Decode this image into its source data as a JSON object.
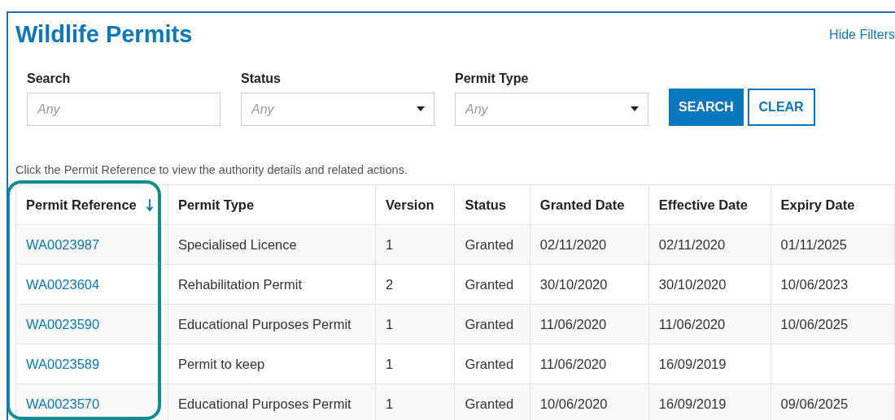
{
  "title": "Wildlife Permits",
  "hide_filters_link": "Hide Filters",
  "filters": [
    {
      "kind": "text",
      "label": "Search",
      "placeholder": "Any"
    },
    {
      "kind": "select",
      "label": "Status",
      "placeholder": "Any"
    },
    {
      "kind": "select",
      "label": "Permit Type",
      "placeholder": "Any"
    }
  ],
  "buttons": [
    {
      "label": "SEARCH",
      "kind": "primary"
    },
    {
      "label": "CLEAR",
      "kind": "secondary"
    }
  ],
  "hint": "Click the Permit Reference to view the authority details and related actions.",
  "table": {
    "columns": [
      {
        "label": "Permit Reference",
        "sorted": true,
        "highlighted": true
      },
      {
        "label": "Permit Type",
        "sorted": false,
        "highlighted": false
      },
      {
        "label": "Version",
        "sorted": false,
        "highlighted": false
      },
      {
        "label": "Status",
        "sorted": false,
        "highlighted": false
      },
      {
        "label": "Granted Date",
        "sorted": false,
        "highlighted": false
      },
      {
        "label": "Effective Date",
        "sorted": false,
        "highlighted": false
      },
      {
        "label": "Expiry Date",
        "sorted": false,
        "highlighted": false
      }
    ],
    "rows": [
      [
        "WA0023987",
        "Specialised Licence",
        "1",
        "Granted",
        "02/11/2020",
        "02/11/2020",
        "01/11/2025"
      ],
      [
        "WA0023604",
        "Rehabilitation Permit",
        "2",
        "Granted",
        "30/10/2020",
        "30/10/2020",
        "10/06/2023"
      ],
      [
        "WA0023590",
        "Educational Purposes Permit",
        "1",
        "Granted",
        "11/06/2020",
        "11/06/2020",
        "10/06/2025"
      ],
      [
        "WA0023589",
        "Permit to keep",
        "1",
        "Granted",
        "11/06/2020",
        "16/09/2019",
        ""
      ],
      [
        "WA0023570",
        "Educational Purposes Permit",
        "1",
        "Granted",
        "10/06/2020",
        "16/09/2019",
        "09/06/2025"
      ]
    ]
  }
}
